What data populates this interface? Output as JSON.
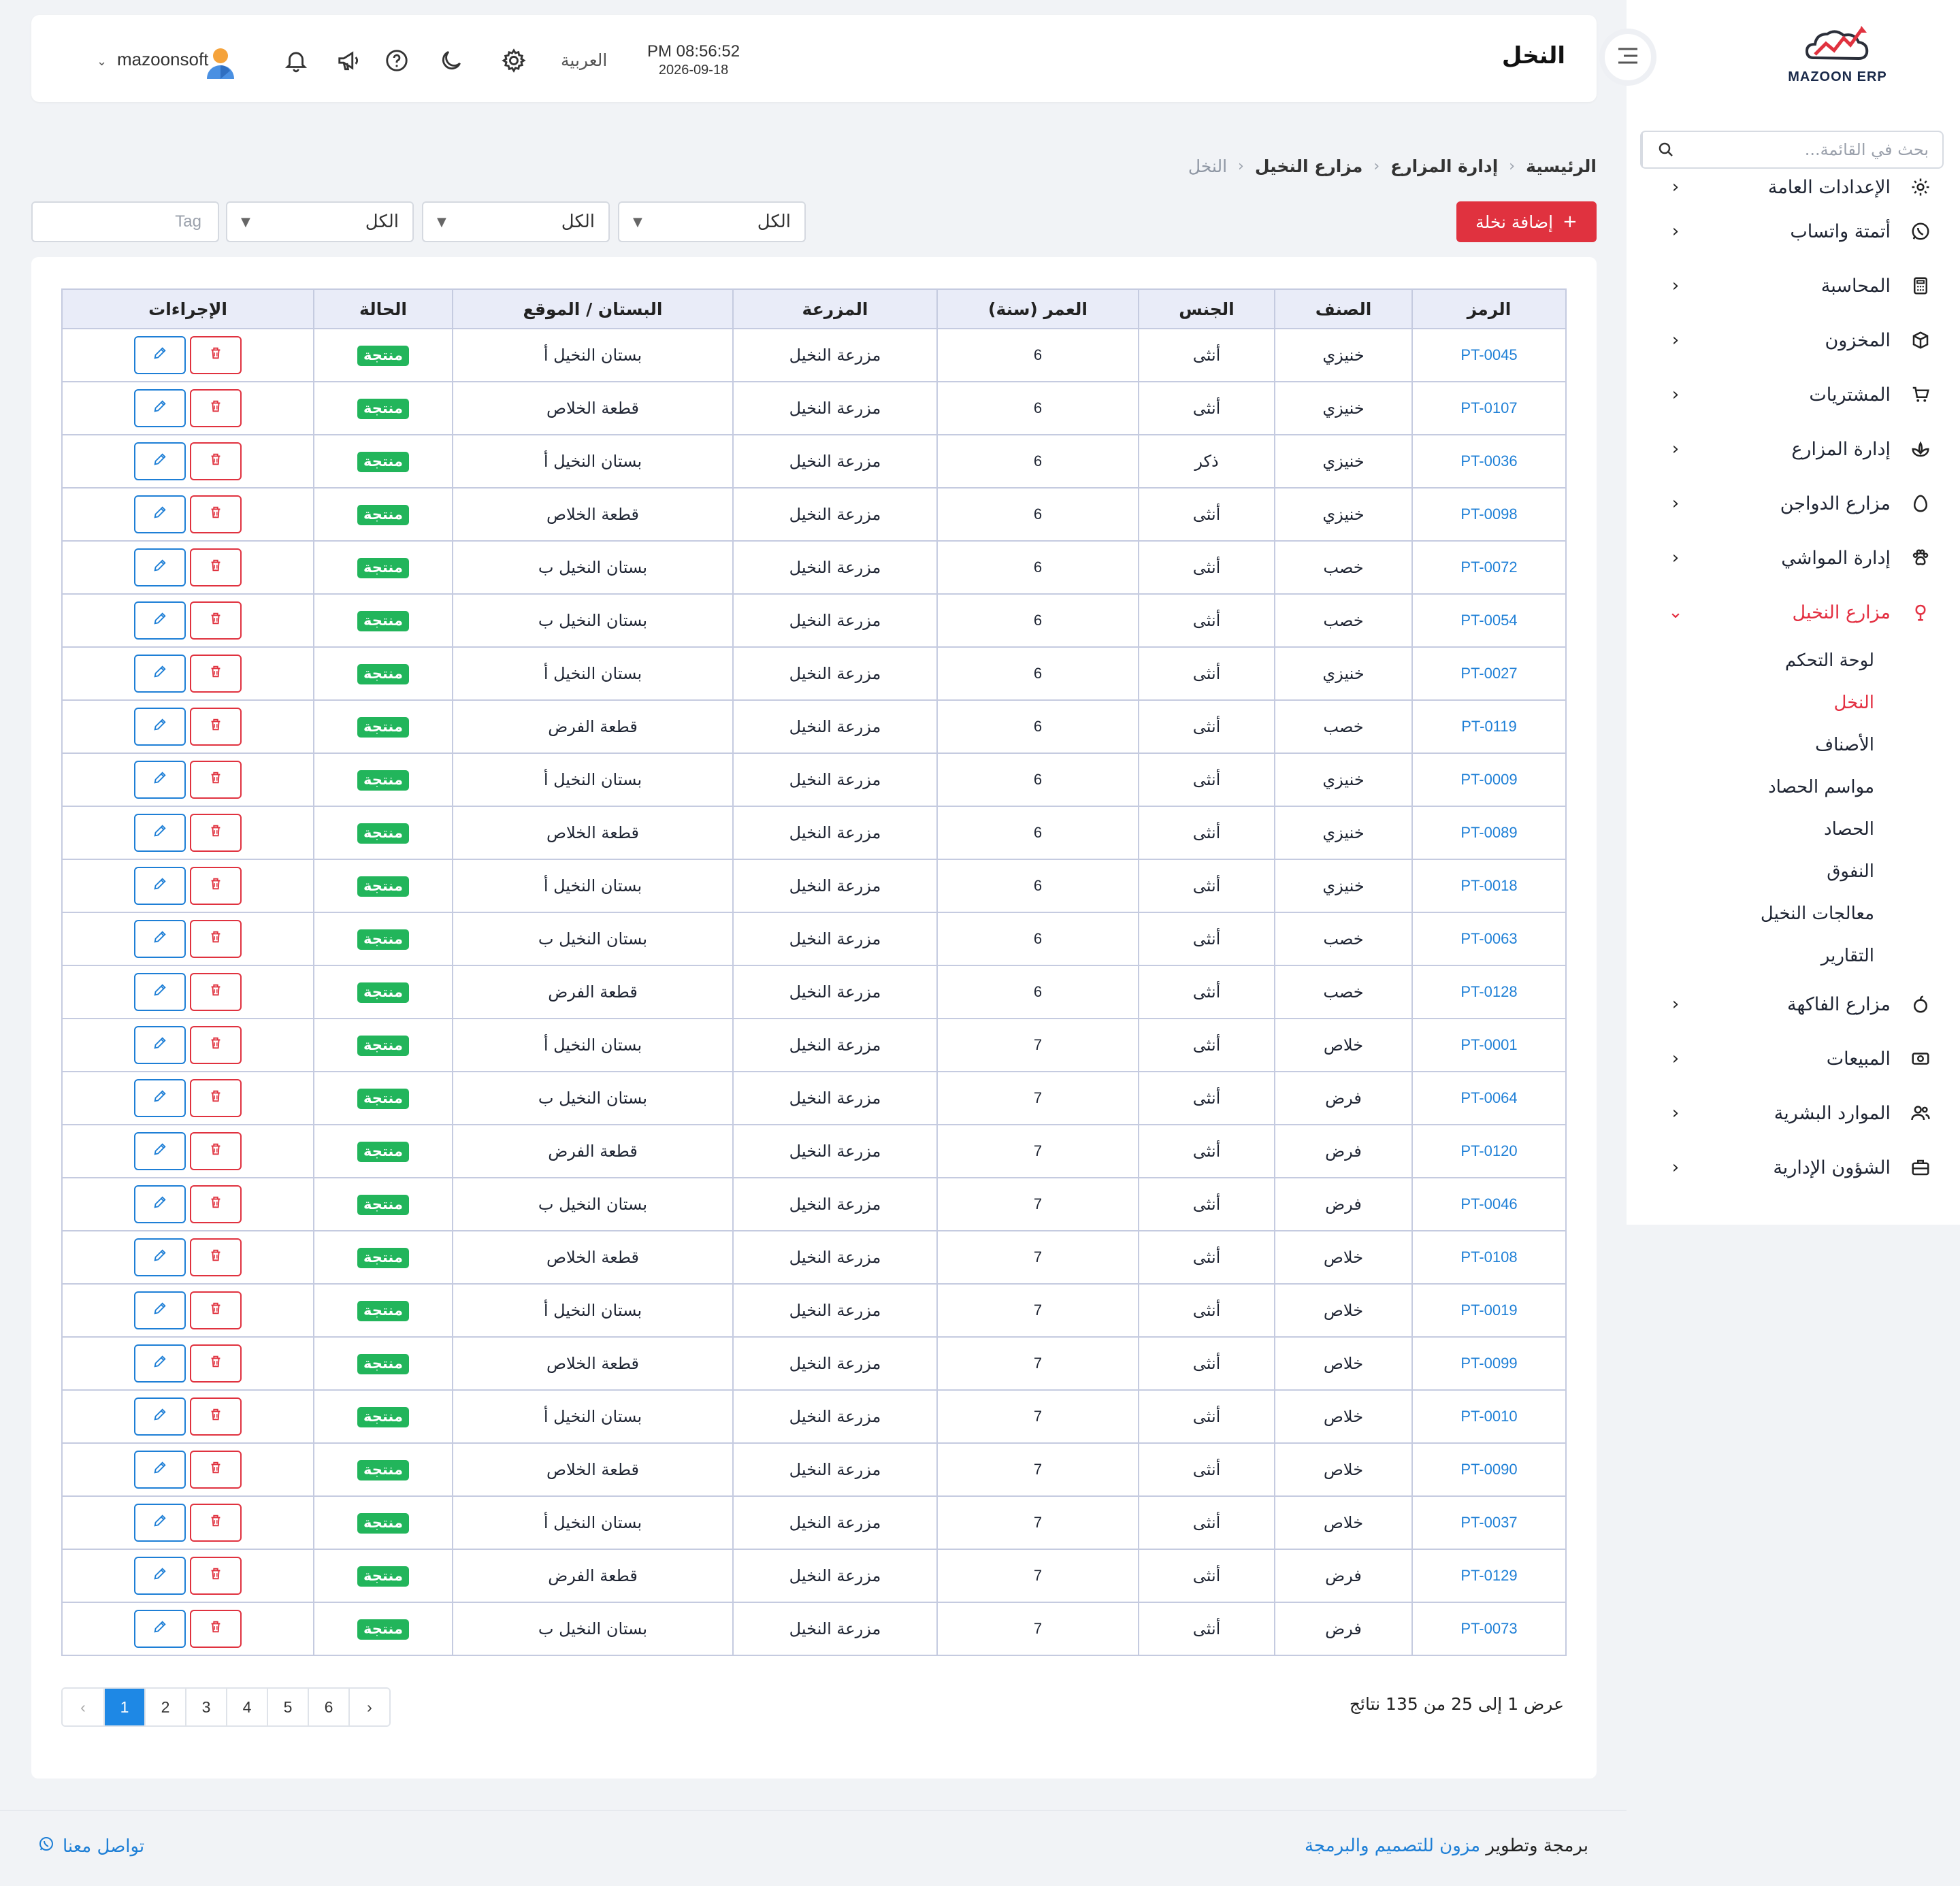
{
  "app": {
    "logo_text": "MAZOON ERP",
    "colors": {
      "primary_red": "#e0323f",
      "link_blue": "#1e7fd6",
      "status_green": "#22b55b"
    }
  },
  "sidebar": {
    "search_placeholder": "بحث في القائمة...",
    "menu": [
      {
        "label": "الإعدادات العامة",
        "icon": "gear-icon"
      },
      {
        "label": "أتمتة واتساب",
        "icon": "whatsapp-icon"
      },
      {
        "label": "المحاسبة",
        "icon": "calculator-icon"
      },
      {
        "label": "المخزون",
        "icon": "box-icon"
      },
      {
        "label": "المشتريات",
        "icon": "cart-icon"
      },
      {
        "label": "إدارة المزارع",
        "icon": "leaf-icon"
      },
      {
        "label": "مزارع الدواجن",
        "icon": "egg-icon"
      },
      {
        "label": "إدارة المواشي",
        "icon": "paw-icon"
      },
      {
        "label": "مزارع النخيل",
        "icon": "palm-icon",
        "expanded": true
      },
      {
        "label": "مزارع الفاكهة",
        "icon": "fruit-icon"
      },
      {
        "label": "المبيعات",
        "icon": "cash-icon"
      },
      {
        "label": "الموارد البشرية",
        "icon": "users-icon"
      },
      {
        "label": "الشؤون الإدارية",
        "icon": "briefcase-icon"
      }
    ],
    "submenu": [
      {
        "label": "لوحة التحكم"
      },
      {
        "label": "النخل",
        "active": true
      },
      {
        "label": "الأصناف"
      },
      {
        "label": "مواسم الحصاد"
      },
      {
        "label": "الحصاد"
      },
      {
        "label": "النفوق"
      },
      {
        "label": "معالجات النخيل"
      },
      {
        "label": "التقارير"
      }
    ]
  },
  "header": {
    "title": "النخل",
    "time": "PM 08:56:52",
    "date": "2026-09-18",
    "language": "العربية",
    "user": "mazoonsoft"
  },
  "breadcrumb": [
    "الرئيسية",
    "إدارة المزارع",
    "مزارع النخيل",
    "النخل"
  ],
  "toolbar": {
    "add_label": "إضافة نخلة",
    "filter1": "الكل",
    "filter2": "الكل",
    "filter3": "الكل",
    "tag_placeholder": "Tag"
  },
  "table": {
    "headers": {
      "code": "الرمز",
      "variety": "الصنف",
      "sex": "الجنس",
      "age": "العمر (سنة)",
      "farm": "المزرعة",
      "location": "البستان / الموقع",
      "status": "الحالة",
      "actions": "الإجراءات"
    },
    "rows": [
      {
        "code": "PT-0045",
        "variety": "خنيزي",
        "sex": "أنثى",
        "age": "6",
        "farm": "مزرعة النخيل",
        "location": "بستان النخيل أ",
        "status": "منتجة"
      },
      {
        "code": "PT-0107",
        "variety": "خنيزي",
        "sex": "أنثى",
        "age": "6",
        "farm": "مزرعة النخيل",
        "location": "قطعة الخلاص",
        "status": "منتجة"
      },
      {
        "code": "PT-0036",
        "variety": "خنيزي",
        "sex": "ذكر",
        "age": "6",
        "farm": "مزرعة النخيل",
        "location": "بستان النخيل أ",
        "status": "منتجة"
      },
      {
        "code": "PT-0098",
        "variety": "خنيزي",
        "sex": "أنثى",
        "age": "6",
        "farm": "مزرعة النخيل",
        "location": "قطعة الخلاص",
        "status": "منتجة"
      },
      {
        "code": "PT-0072",
        "variety": "خصب",
        "sex": "أنثى",
        "age": "6",
        "farm": "مزرعة النخيل",
        "location": "بستان النخيل ب",
        "status": "منتجة"
      },
      {
        "code": "PT-0054",
        "variety": "خصب",
        "sex": "أنثى",
        "age": "6",
        "farm": "مزرعة النخيل",
        "location": "بستان النخيل ب",
        "status": "منتجة"
      },
      {
        "code": "PT-0027",
        "variety": "خنيزي",
        "sex": "أنثى",
        "age": "6",
        "farm": "مزرعة النخيل",
        "location": "بستان النخيل أ",
        "status": "منتجة"
      },
      {
        "code": "PT-0119",
        "variety": "خصب",
        "sex": "أنثى",
        "age": "6",
        "farm": "مزرعة النخيل",
        "location": "قطعة الفرض",
        "status": "منتجة"
      },
      {
        "code": "PT-0009",
        "variety": "خنيزي",
        "sex": "أنثى",
        "age": "6",
        "farm": "مزرعة النخيل",
        "location": "بستان النخيل أ",
        "status": "منتجة"
      },
      {
        "code": "PT-0089",
        "variety": "خنيزي",
        "sex": "أنثى",
        "age": "6",
        "farm": "مزرعة النخيل",
        "location": "قطعة الخلاص",
        "status": "منتجة"
      },
      {
        "code": "PT-0018",
        "variety": "خنيزي",
        "sex": "أنثى",
        "age": "6",
        "farm": "مزرعة النخيل",
        "location": "بستان النخيل أ",
        "status": "منتجة"
      },
      {
        "code": "PT-0063",
        "variety": "خصب",
        "sex": "أنثى",
        "age": "6",
        "farm": "مزرعة النخيل",
        "location": "بستان النخيل ب",
        "status": "منتجة"
      },
      {
        "code": "PT-0128",
        "variety": "خصب",
        "sex": "أنثى",
        "age": "6",
        "farm": "مزرعة النخيل",
        "location": "قطعة الفرض",
        "status": "منتجة"
      },
      {
        "code": "PT-0001",
        "variety": "خلاص",
        "sex": "أنثى",
        "age": "7",
        "farm": "مزرعة النخيل",
        "location": "بستان النخيل أ",
        "status": "منتجة"
      },
      {
        "code": "PT-0064",
        "variety": "فرض",
        "sex": "أنثى",
        "age": "7",
        "farm": "مزرعة النخيل",
        "location": "بستان النخيل ب",
        "status": "منتجة"
      },
      {
        "code": "PT-0120",
        "variety": "فرض",
        "sex": "أنثى",
        "age": "7",
        "farm": "مزرعة النخيل",
        "location": "قطعة الفرض",
        "status": "منتجة"
      },
      {
        "code": "PT-0046",
        "variety": "فرض",
        "sex": "أنثى",
        "age": "7",
        "farm": "مزرعة النخيل",
        "location": "بستان النخيل ب",
        "status": "منتجة"
      },
      {
        "code": "PT-0108",
        "variety": "خلاص",
        "sex": "أنثى",
        "age": "7",
        "farm": "مزرعة النخيل",
        "location": "قطعة الخلاص",
        "status": "منتجة"
      },
      {
        "code": "PT-0019",
        "variety": "خلاص",
        "sex": "أنثى",
        "age": "7",
        "farm": "مزرعة النخيل",
        "location": "بستان النخيل أ",
        "status": "منتجة"
      },
      {
        "code": "PT-0099",
        "variety": "خلاص",
        "sex": "أنثى",
        "age": "7",
        "farm": "مزرعة النخيل",
        "location": "قطعة الخلاص",
        "status": "منتجة"
      },
      {
        "code": "PT-0010",
        "variety": "خلاص",
        "sex": "أنثى",
        "age": "7",
        "farm": "مزرعة النخيل",
        "location": "بستان النخيل أ",
        "status": "منتجة"
      },
      {
        "code": "PT-0090",
        "variety": "خلاص",
        "sex": "أنثى",
        "age": "7",
        "farm": "مزرعة النخيل",
        "location": "قطعة الخلاص",
        "status": "منتجة"
      },
      {
        "code": "PT-0037",
        "variety": "خلاص",
        "sex": "أنثى",
        "age": "7",
        "farm": "مزرعة النخيل",
        "location": "بستان النخيل أ",
        "status": "منتجة"
      },
      {
        "code": "PT-0129",
        "variety": "فرض",
        "sex": "أنثى",
        "age": "7",
        "farm": "مزرعة النخيل",
        "location": "قطعة الفرض",
        "status": "منتجة"
      },
      {
        "code": "PT-0073",
        "variety": "فرض",
        "sex": "أنثى",
        "age": "7",
        "farm": "مزرعة النخيل",
        "location": "بستان النخيل ب",
        "status": "منتجة"
      }
    ]
  },
  "pagination": {
    "summary": "عرض 1 إلى 25 من 135 نتائج",
    "prev": "‹",
    "next": "›",
    "pages": [
      "1",
      "2",
      "3",
      "4",
      "5",
      "6"
    ],
    "current": "1"
  },
  "footer": {
    "credit_prefix": "برمجة وتطوير",
    "credit_brand": "مزون للتصميم والبرمجة",
    "contact": "تواصل معنا"
  }
}
